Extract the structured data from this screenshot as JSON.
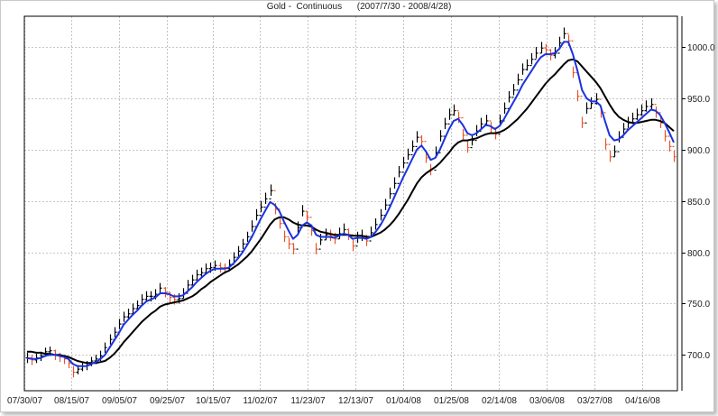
{
  "chart_data": {
    "type": "line",
    "title": "Gold -  Continuous",
    "subtitle": "(2007/7/30 - 2008/4/28)",
    "x_tick_labels": [
      "07/30/07",
      "08/15/07",
      "09/05/07",
      "09/25/07",
      "10/15/07",
      "11/02/07",
      "11/23/07",
      "12/13/07",
      "01/04/08",
      "01/25/08",
      "02/14/08",
      "03/06/08",
      "03/27/08",
      "04/16/08"
    ],
    "y_tick_labels": [
      "700.0",
      "750.0",
      "800.0",
      "850.0",
      "900.0",
      "950.0",
      "1000.0"
    ],
    "ylim": [
      665,
      1030
    ],
    "grid": true,
    "colors": {
      "up_bar": "#000000",
      "down_bar": "#e8542a",
      "fast_ma": "#1a33e0",
      "slow_ma": "#000000",
      "grid": "#b4b4b4"
    },
    "series": [
      {
        "name": "",
        "kind": "ohlc",
        "close": [
          697,
          695,
          697,
          699,
          703,
          704,
          700,
          698,
          696,
          692,
          683,
          686,
          689,
          690,
          694,
          696,
          699,
          707,
          715,
          722,
          730,
          737,
          740,
          745,
          748,
          754,
          757,
          757,
          759,
          765,
          761,
          756,
          754,
          755,
          760,
          768,
          773,
          778,
          780,
          784,
          785,
          787,
          785,
          784,
          788,
          795,
          801,
          808,
          815,
          825,
          836,
          844,
          852,
          860,
          842,
          828,
          815,
          808,
          803,
          824,
          840,
          834,
          821,
          803,
          812,
          817,
          816,
          813,
          818,
          822,
          817,
          806,
          814,
          816,
          811,
          819,
          827,
          836,
          846,
          857,
          867,
          878,
          887,
          895,
          903,
          912,
          908,
          892,
          880,
          897,
          913,
          925,
          934,
          938,
          931,
          914,
          902,
          909,
          918,
          925,
          928,
          921,
          915,
          928,
          940,
          951,
          958,
          968,
          978,
          982,
          988,
          994,
          999,
          997,
          992,
          994,
          1004,
          1013,
          1006,
          975,
          952,
          926,
          940,
          945,
          949,
          936,
          905,
          893,
          898,
          912,
          920,
          926,
          930,
          934,
          938,
          942,
          944,
          936,
          926,
          913,
          903,
          893
        ],
        "high": [
          702,
          700,
          701,
          703,
          707,
          708,
          705,
          702,
          700,
          697,
          689,
          690,
          693,
          694,
          698,
          700,
          704,
          712,
          720,
          727,
          735,
          742,
          745,
          750,
          753,
          759,
          762,
          762,
          764,
          770,
          766,
          761,
          759,
          760,
          765,
          773,
          778,
          783,
          785,
          789,
          790,
          792,
          790,
          789,
          793,
          800,
          806,
          813,
          820,
          831,
          842,
          850,
          858,
          866,
          848,
          834,
          821,
          814,
          809,
          830,
          846,
          840,
          827,
          809,
          818,
          823,
          822,
          819,
          824,
          828,
          823,
          812,
          820,
          822,
          817,
          825,
          833,
          842,
          852,
          863,
          873,
          884,
          893,
          901,
          909,
          918,
          914,
          898,
          886,
          903,
          919,
          931,
          940,
          944,
          937,
          920,
          908,
          915,
          924,
          931,
          934,
          927,
          921,
          934,
          946,
          957,
          964,
          974,
          984,
          988,
          994,
          1000,
          1005,
          1003,
          998,
          1000,
          1010,
          1019,
          1012,
          981,
          958,
          932,
          946,
          951,
          955,
          942,
          911,
          899,
          904,
          918,
          926,
          932,
          936,
          940,
          944,
          948,
          950,
          942,
          932,
          919,
          909,
          899
        ],
        "low": [
          692,
          690,
          692,
          694,
          698,
          699,
          695,
          693,
          691,
          687,
          678,
          681,
          684,
          685,
          689,
          691,
          694,
          702,
          710,
          717,
          725,
          732,
          735,
          740,
          743,
          749,
          752,
          752,
          754,
          760,
          756,
          751,
          749,
          750,
          755,
          763,
          768,
          773,
          775,
          779,
          780,
          782,
          780,
          779,
          783,
          790,
          796,
          803,
          810,
          820,
          831,
          839,
          847,
          855,
          837,
          823,
          810,
          803,
          798,
          819,
          835,
          829,
          816,
          798,
          807,
          812,
          811,
          808,
          813,
          817,
          812,
          801,
          809,
          811,
          806,
          814,
          822,
          831,
          841,
          852,
          862,
          873,
          882,
          890,
          898,
          907,
          903,
          887,
          875,
          892,
          908,
          920,
          929,
          933,
          926,
          909,
          897,
          904,
          913,
          920,
          923,
          916,
          910,
          923,
          935,
          946,
          953,
          963,
          973,
          977,
          983,
          989,
          994,
          992,
          987,
          989,
          999,
          1008,
          1001,
          970,
          947,
          921,
          935,
          940,
          944,
          931,
          900,
          888,
          893,
          907,
          915,
          921,
          925,
          929,
          933,
          937,
          939,
          931,
          921,
          908,
          898,
          888
        ]
      },
      {
        "name": "",
        "kind": "fast_ma",
        "values": [
          697,
          696,
          696,
          697,
          699,
          700,
          700,
          699,
          698,
          696,
          691,
          689,
          689,
          689,
          691,
          693,
          696,
          700,
          707,
          714,
          721,
          729,
          734,
          739,
          743,
          748,
          752,
          754,
          756,
          760,
          760,
          759,
          757,
          757,
          758,
          762,
          766,
          771,
          775,
          779,
          782,
          784,
          784,
          784,
          785,
          789,
          794,
          800,
          807,
          815,
          824,
          833,
          841,
          849,
          846,
          840,
          830,
          821,
          813,
          817,
          826,
          829,
          826,
          817,
          815,
          815,
          815,
          814,
          816,
          818,
          817,
          813,
          814,
          814,
          813,
          815,
          820,
          826,
          834,
          843,
          853,
          863,
          873,
          882,
          891,
          900,
          904,
          898,
          890,
          892,
          900,
          910,
          920,
          928,
          930,
          924,
          916,
          914,
          916,
          920,
          924,
          923,
          920,
          923,
          930,
          938,
          946,
          954,
          963,
          970,
          977,
          984,
          990,
          993,
          993,
          994,
          998,
          1005,
          1005,
          993,
          977,
          958,
          950,
          947,
          947,
          943,
          928,
          914,
          909,
          910,
          914,
          919,
          923,
          927,
          931,
          935,
          939,
          938,
          934,
          926,
          917,
          907
        ]
      },
      {
        "name": "",
        "kind": "slow_ma",
        "values": [
          703,
          703,
          702,
          702,
          701,
          701,
          700,
          700,
          699,
          698,
          696,
          694,
          693,
          692,
          692,
          692,
          693,
          694,
          697,
          701,
          706,
          712,
          717,
          722,
          727,
          732,
          736,
          740,
          743,
          747,
          749,
          750,
          751,
          752,
          753,
          755,
          757,
          760,
          764,
          767,
          771,
          774,
          777,
          780,
          782,
          785,
          788,
          792,
          796,
          801,
          807,
          813,
          820,
          827,
          832,
          834,
          834,
          832,
          829,
          827,
          826,
          826,
          825,
          822,
          820,
          819,
          818,
          817,
          817,
          817,
          817,
          816,
          816,
          816,
          815,
          815,
          817,
          819,
          822,
          826,
          831,
          837,
          844,
          851,
          859,
          867,
          873,
          877,
          880,
          883,
          887,
          892,
          897,
          903,
          907,
          909,
          909,
          910,
          911,
          913,
          915,
          916,
          916,
          917,
          919,
          922,
          926,
          930,
          935,
          940,
          946,
          952,
          958,
          964,
          969,
          973,
          978,
          983,
          987,
          988,
          986,
          981,
          976,
          971,
          966,
          960,
          952,
          944,
          937,
          932,
          929,
          927,
          926,
          926,
          927,
          928,
          929,
          929,
          928,
          926,
          922,
          918
        ]
      }
    ]
  }
}
